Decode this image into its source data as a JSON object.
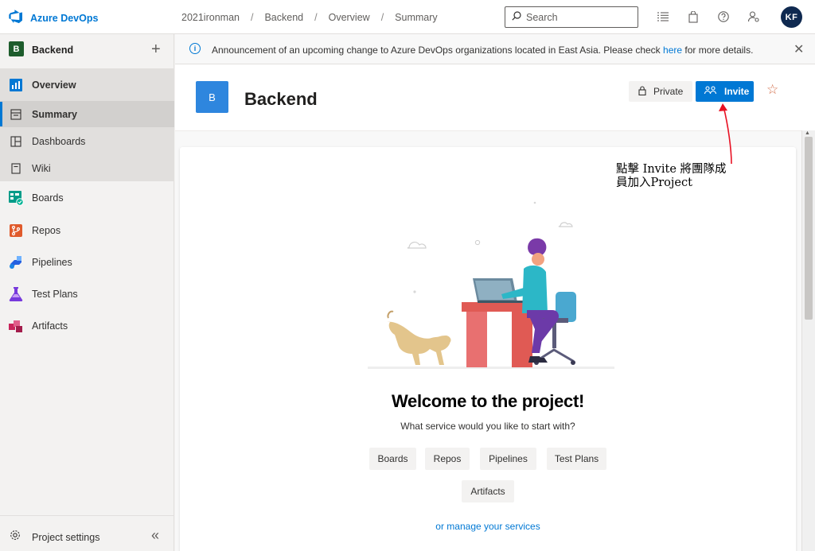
{
  "app": {
    "name": "Azure DevOps"
  },
  "breadcrumb": [
    "2021ironman",
    "Backend",
    "Overview",
    "Summary"
  ],
  "search": {
    "placeholder": "Search"
  },
  "user": {
    "initials": "KF"
  },
  "sidebar": {
    "project_badge": "B",
    "project_name": "Backend",
    "items": [
      {
        "label": "Overview",
        "icon": "overview-icon"
      },
      {
        "label": "Summary",
        "icon": "summary-icon"
      },
      {
        "label": "Dashboards",
        "icon": "dashboards-icon"
      },
      {
        "label": "Wiki",
        "icon": "wiki-icon"
      },
      {
        "label": "Boards",
        "icon": "boards-icon"
      },
      {
        "label": "Repos",
        "icon": "repos-icon"
      },
      {
        "label": "Pipelines",
        "icon": "pipelines-icon"
      },
      {
        "label": "Test Plans",
        "icon": "test-plans-icon"
      },
      {
        "label": "Artifacts",
        "icon": "artifacts-icon"
      }
    ],
    "footer_label": "Project settings"
  },
  "announcement": {
    "text_before": "Announcement of an upcoming change to Azure DevOps organizations located in East Asia. Please check ",
    "link": "here",
    "text_after": " for more details."
  },
  "project": {
    "badge": "B",
    "title": "Backend",
    "private_label": "Private",
    "invite_label": "Invite"
  },
  "welcome": {
    "title": "Welcome to the project!",
    "subtitle": "What service would you like to start with?",
    "services": [
      "Boards",
      "Repos",
      "Pipelines",
      "Test Plans",
      "Artifacts"
    ],
    "manage_link": "or manage your services"
  },
  "annotation": {
    "line1": "點擊 Invite 將團隊成",
    "line2": "員加入Project",
    "color": "#e81123"
  },
  "colors": {
    "accent": "#0078d4",
    "project_sidebar_badge": "#1d5c2c",
    "project_badge": "#2e86de",
    "avatar": "#0f2950"
  }
}
